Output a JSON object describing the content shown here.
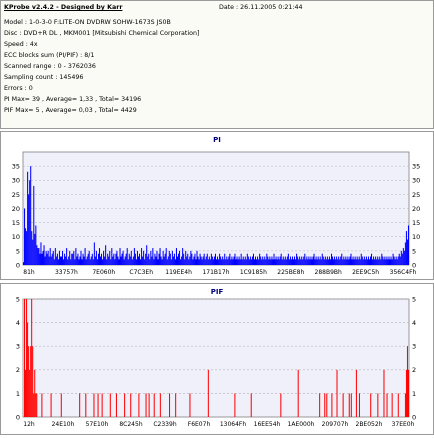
{
  "header": {
    "title": "KProbe v2.4.2 - Designed by Karr",
    "date": "Date : 26.11.2005 0:21:44",
    "lines": [
      "Model : 1-0-3-0 F:LITE-ON DVDRW SOHW-1673S JS0B",
      "Disc : DVD+R DL , MKM001 [Mitsubishi Chemical Corporation]",
      "Speed : 4x",
      "ECC blocks sum (PI/PIF) : 8/1",
      "Scanned range : 0 - 3762036",
      "Sampling count : 145496",
      "Errors : 0",
      "PI Max= 39 , Average= 1,33 , Total= 34196",
      "PIF Max= 5 , Average= 0,03 , Total= 4429"
    ]
  },
  "colors": {
    "series": "#0000ff",
    "series2": "#ff0000",
    "plot_bg": "#f0f0fa",
    "grid": "#b4b4b4"
  },
  "chart_data": [
    {
      "type": "bar",
      "title": "PI",
      "ylim": [
        0,
        40
      ],
      "yticks": [
        0,
        5,
        10,
        15,
        20,
        25,
        30,
        35
      ],
      "x_tick_labels": [
        "81h",
        "33757h",
        "7E060h",
        "C7C3Eh",
        "119EE4h",
        "171B17h",
        "1C9185h",
        "225BE8h",
        "288B9Bh",
        "2EE9C5h",
        "356C4Fh"
      ],
      "grid": true,
      "series": [
        {
          "values": [
            1,
            20,
            13,
            12,
            33,
            25,
            30,
            35,
            12,
            9,
            28,
            11,
            14,
            7,
            6,
            6,
            4,
            8,
            4,
            5,
            7,
            3,
            5,
            4,
            5,
            3,
            6,
            3,
            4,
            5,
            2,
            6,
            3,
            4,
            2,
            5,
            3,
            3,
            5,
            2,
            4,
            3,
            6,
            2,
            3,
            5,
            2,
            4,
            4,
            5,
            2,
            6,
            3,
            4,
            2,
            3,
            5,
            2,
            4,
            3,
            6,
            2,
            3,
            4,
            5,
            2,
            3,
            4,
            2,
            8,
            3,
            5,
            2,
            4,
            6,
            3,
            4,
            2,
            5,
            3,
            7,
            2,
            4,
            3,
            5,
            2,
            6,
            3,
            4,
            2,
            4,
            5,
            3,
            2,
            6,
            3,
            4,
            5,
            2,
            3,
            4,
            6,
            2,
            4,
            3,
            5,
            2,
            3,
            6,
            4,
            2,
            5,
            3,
            4,
            2,
            6,
            3,
            5,
            2,
            4,
            7,
            3,
            4,
            2,
            5,
            3,
            6,
            2,
            4,
            3,
            5,
            2,
            4,
            6,
            3,
            2,
            5,
            3,
            4,
            6,
            2,
            3,
            5,
            4,
            2,
            5,
            3,
            4,
            2,
            6,
            3,
            4,
            5,
            2,
            3,
            6,
            4,
            2,
            5,
            3,
            4,
            2,
            3,
            5,
            4,
            2,
            3,
            4,
            2,
            5,
            3,
            2,
            4,
            3,
            2,
            3,
            4,
            2,
            3,
            4,
            2,
            3,
            2,
            4,
            3,
            2,
            3,
            4,
            2,
            3,
            2,
            4,
            3,
            2,
            3,
            2,
            4,
            2,
            3,
            2,
            3,
            4,
            2,
            3,
            2,
            3,
            4,
            2,
            3,
            2,
            3,
            2,
            4,
            2,
            3,
            2,
            3,
            2,
            4,
            3,
            2,
            3,
            2,
            3,
            4,
            2,
            3,
            2,
            3,
            2,
            4,
            3,
            2,
            3,
            2,
            3,
            2,
            4,
            3,
            2,
            3,
            2,
            3,
            2,
            4,
            2,
            3,
            2,
            3,
            2,
            3,
            4,
            2,
            3,
            2,
            3,
            2,
            3,
            4,
            2,
            3,
            2,
            3,
            2,
            3,
            2,
            4,
            3,
            2,
            3,
            2,
            3,
            2,
            3,
            4,
            2,
            3,
            2,
            3,
            2,
            3,
            2,
            3,
            4,
            2,
            3,
            2,
            3,
            2,
            3,
            2,
            4,
            3,
            2,
            3,
            2,
            3,
            2,
            3,
            2,
            4,
            3,
            2,
            3,
            2,
            3,
            2,
            3,
            2,
            3,
            4,
            2,
            3,
            2,
            3,
            2,
            3,
            2,
            3,
            4,
            2,
            3,
            2,
            3,
            2,
            3,
            2,
            3,
            2,
            4,
            3,
            2,
            3,
            2,
            3,
            2,
            3,
            2,
            3,
            4,
            2,
            3,
            2,
            3,
            2,
            3,
            2,
            3,
            2,
            4,
            3,
            2,
            3,
            2,
            3,
            2,
            3,
            2,
            3,
            2,
            4,
            3,
            2,
            3,
            2,
            3,
            4,
            3,
            5,
            4,
            6,
            5,
            8,
            12,
            9,
            14
          ]
        }
      ]
    },
    {
      "type": "bar",
      "title": "PIF",
      "ylim": [
        0,
        5
      ],
      "yticks": [
        0,
        1,
        2,
        3,
        4,
        5
      ],
      "x_tick_labels": [
        "12h",
        "24E10h",
        "57E10h",
        "8C245h",
        "C2339h",
        "F6E07h",
        "13064Fh",
        "16EE54h",
        "1AE000h",
        "209707h",
        "2BE052h",
        "37EE0h"
      ],
      "grid": true,
      "series": [
        {
          "values": [
            0,
            5,
            2,
            5,
            4,
            3,
            2,
            3,
            5,
            3,
            1,
            2,
            1,
            1,
            0,
            0,
            0,
            0,
            1,
            0,
            0,
            0,
            0,
            0,
            0,
            0,
            0,
            1,
            0,
            0,
            0,
            0,
            0,
            0,
            0,
            0,
            0,
            1,
            0,
            0,
            0,
            0,
            0,
            0,
            0,
            0,
            0,
            0,
            0,
            0,
            0,
            0,
            0,
            0,
            0,
            1,
            0,
            0,
            0,
            0,
            0,
            1,
            0,
            0,
            0,
            0,
            0,
            0,
            0,
            1,
            0,
            0,
            0,
            1,
            0,
            0,
            0,
            1,
            0,
            0,
            0,
            0,
            0,
            0,
            0,
            1,
            0,
            0,
            0,
            0,
            0,
            1,
            0,
            0,
            0,
            0,
            0,
            0,
            0,
            1,
            0,
            0,
            0,
            0,
            0,
            1,
            0,
            0,
            0,
            0,
            0,
            0,
            0,
            1,
            0,
            0,
            0,
            0,
            0,
            0,
            1,
            0,
            0,
            1,
            0,
            0,
            0,
            0,
            1,
            0,
            0,
            0,
            0,
            0,
            1,
            0,
            0,
            0,
            0,
            0,
            0,
            0,
            0,
            1,
            0,
            0,
            0,
            0,
            0,
            1,
            0,
            0,
            0,
            0,
            0,
            0,
            0,
            0,
            0,
            0,
            0,
            0,
            0,
            1,
            0,
            0,
            0,
            0,
            0,
            0,
            0,
            0,
            0,
            0,
            0,
            0,
            0,
            0,
            0,
            0,
            0,
            2,
            0,
            0,
            0,
            0,
            0,
            0,
            0,
            0,
            0,
            0,
            0,
            0,
            0,
            0,
            0,
            0,
            0,
            0,
            0,
            0,
            0,
            0,
            0,
            0,
            0,
            1,
            0,
            0,
            0,
            0,
            0,
            0,
            0,
            0,
            0,
            0,
            0,
            0,
            0,
            0,
            0,
            1,
            0,
            0,
            0,
            0,
            0,
            0,
            0,
            0,
            0,
            0,
            0,
            0,
            0,
            0,
            0,
            0,
            0,
            0,
            0,
            0,
            0,
            0,
            0,
            0,
            0,
            0,
            0,
            0,
            1,
            0,
            0,
            0,
            0,
            0,
            0,
            0,
            0,
            0,
            0,
            0,
            0,
            0,
            0,
            0,
            0,
            2,
            0,
            0,
            0,
            0,
            0,
            0,
            0,
            0,
            0,
            0,
            0,
            0,
            0,
            0,
            0,
            0,
            0,
            0,
            0,
            0,
            1,
            0,
            0,
            0,
            0,
            1,
            0,
            1,
            0,
            0,
            0,
            0,
            1,
            0,
            0,
            0,
            0,
            2,
            0,
            0,
            0,
            0,
            0,
            1,
            0,
            0,
            0,
            0,
            0,
            1,
            0,
            1,
            0,
            0,
            0,
            0,
            2,
            0,
            0,
            1,
            0,
            0,
            0,
            0,
            0,
            0,
            0,
            0,
            0,
            0,
            1,
            0,
            0,
            0,
            0,
            0,
            0,
            1,
            0,
            0,
            0,
            0,
            0,
            2,
            0,
            0,
            1,
            0,
            0,
            0,
            0,
            1,
            0,
            0,
            0,
            0,
            0,
            1,
            0,
            0,
            0,
            0,
            0,
            0,
            1,
            2,
            3,
            2
          ]
        }
      ]
    }
  ]
}
